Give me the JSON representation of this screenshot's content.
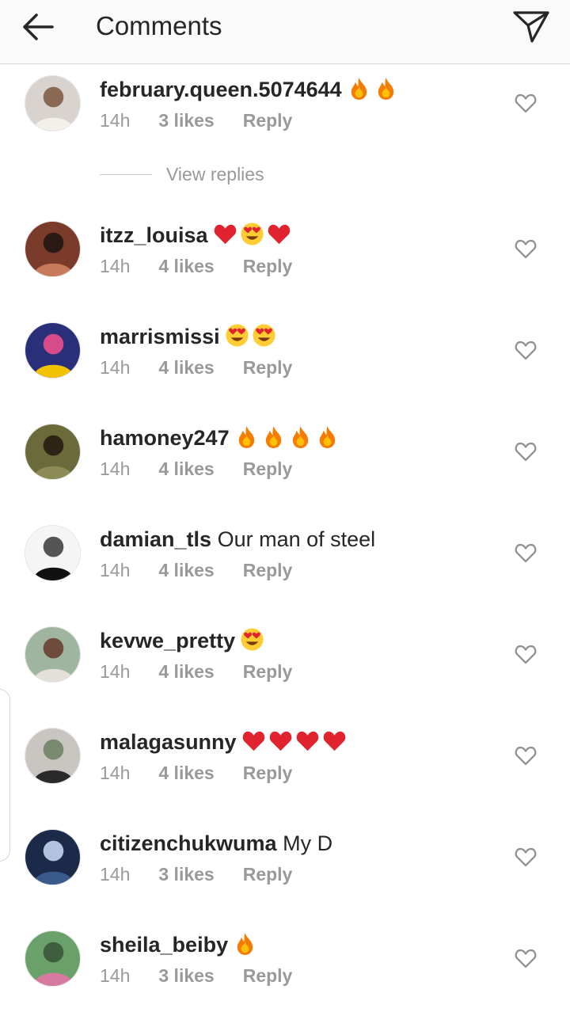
{
  "header": {
    "title": "Comments",
    "back_icon": "arrow-left-icon",
    "send_icon": "paper-plane-icon"
  },
  "view_replies_label": "View replies",
  "reply_label": "Reply",
  "colors": {
    "text": "#262626",
    "muted": "#999999",
    "header_bg": "#fafafa",
    "heart_red": "#e0232e",
    "fire_orange": "#f57c00"
  },
  "comments": [
    {
      "username": "february.queen.5074644",
      "text": "",
      "emojis": [
        "fire",
        "fire"
      ],
      "time": "14h",
      "likes": "3 likes"
    },
    {
      "username": "itzz_louisa",
      "text": "",
      "emojis": [
        "red-heart",
        "heart-eyes",
        "red-heart"
      ],
      "time": "14h",
      "likes": "4 likes"
    },
    {
      "username": "marrismissi",
      "text": "",
      "emojis": [
        "heart-eyes",
        "heart-eyes"
      ],
      "time": "14h",
      "likes": "4 likes"
    },
    {
      "username": "hamoney247",
      "text": "",
      "emojis": [
        "fire",
        "fire",
        "fire",
        "fire"
      ],
      "time": "14h",
      "likes": "4 likes"
    },
    {
      "username": "damian_tls",
      "text": "Our man of steel",
      "emojis": [],
      "time": "14h",
      "likes": "4 likes"
    },
    {
      "username": "kevwe_pretty",
      "text": "",
      "emojis": [
        "heart-eyes"
      ],
      "time": "14h",
      "likes": "4 likes"
    },
    {
      "username": "malagasunny",
      "text": "",
      "emojis": [
        "red-heart",
        "red-heart",
        "red-heart",
        "red-heart"
      ],
      "time": "14h",
      "likes": "4 likes"
    },
    {
      "username": "citizenchukwuma",
      "text": "My D",
      "emojis": [],
      "time": "14h",
      "likes": "3 likes"
    },
    {
      "username": "sheila_beiby",
      "text": "",
      "emojis": [
        "fire"
      ],
      "time": "14h",
      "likes": "3 likes"
    }
  ]
}
